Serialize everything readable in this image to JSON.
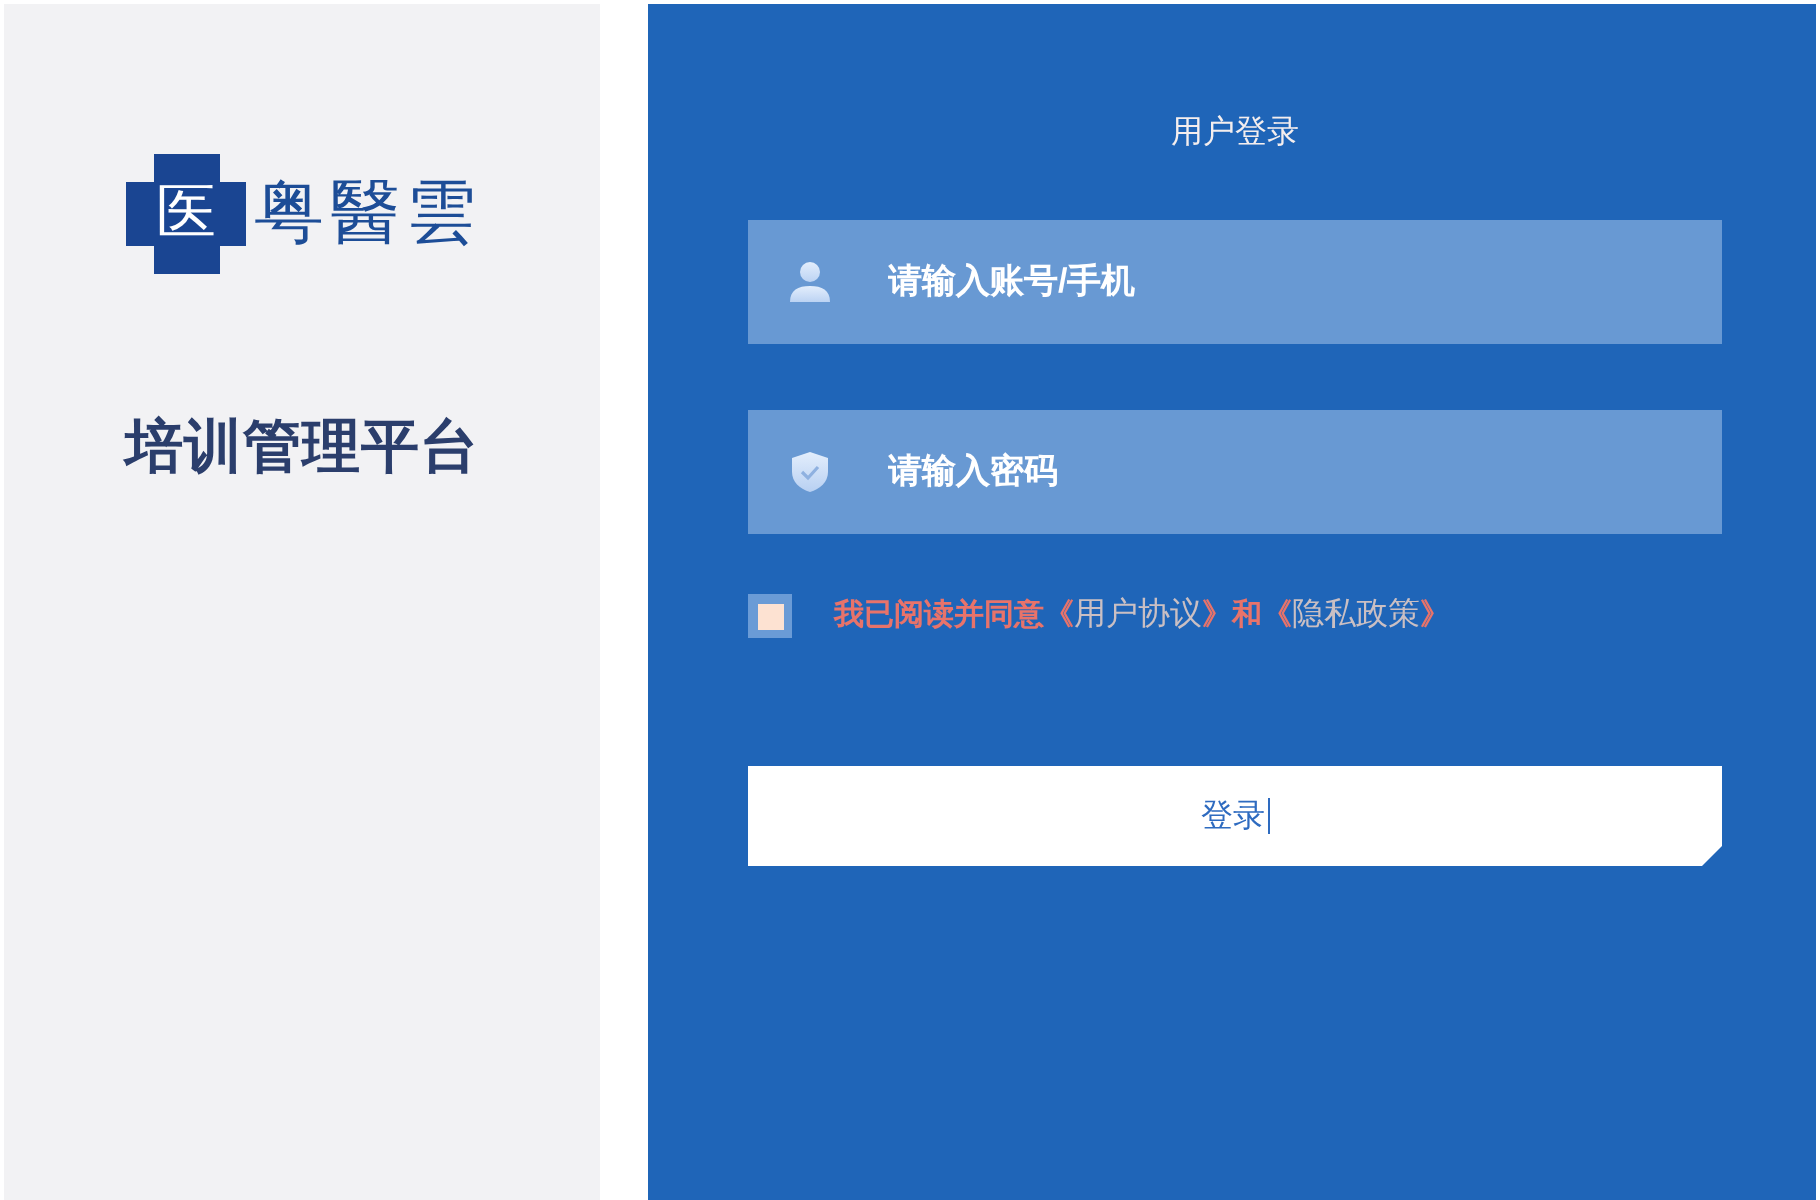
{
  "sidebar": {
    "logo": {
      "emblem": "医",
      "name": "粤醫雲"
    },
    "title": "培训管理平台"
  },
  "login": {
    "title": "用户登录",
    "fields": [
      {
        "kind": "user",
        "placeholder": "请输入账号/手机"
      },
      {
        "kind": "password",
        "placeholder": "请输入密码"
      }
    ],
    "agreement": {
      "checked": false,
      "parts": [
        {
          "kind": "text",
          "text": "我已阅读并同意《"
        },
        {
          "kind": "link",
          "text": "用户协议"
        },
        {
          "kind": "text",
          "text": "》和《"
        },
        {
          "kind": "link",
          "text": "隐私政策"
        },
        {
          "kind": "text",
          "text": "》"
        }
      ]
    },
    "submit": {
      "label": "登录",
      "text_cursor": true
    }
  }
}
